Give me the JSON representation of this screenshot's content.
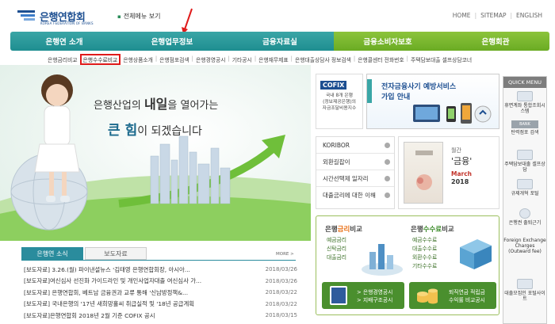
{
  "header": {
    "logo_name": "은행연합회",
    "logo_sub": "KOREA FEDERATION OF BANKS",
    "all_menu": "전체메뉴 보기",
    "util": [
      "HOME",
      "SITEMAP",
      "ENGLISH"
    ]
  },
  "nav": {
    "items": [
      "은행연 소개",
      "은행업무정보",
      "금융자료실",
      "금융소비자보호",
      "은행회관"
    ]
  },
  "subnav": {
    "items": [
      "은행금리비교",
      "은행수수료비교",
      "은행상품소개",
      "은행점포검색",
      "은행경영공시",
      "기타공시",
      "은행재무제표",
      "은행대출상담사 정보검색",
      "은행콜센터 전화번호",
      "주택담보대출 셀프상담코너"
    ]
  },
  "hero": {
    "line1_a": "은행산업의",
    "line1_b": "내일",
    "line1_c": "을 열어가는",
    "line2_a": "큰",
    "line2_b": "힘",
    "line2_c": "이 되겠습니다"
  },
  "news": {
    "tabs": [
      "은행연 소식",
      "보도자료"
    ],
    "more": "MORE >",
    "rows": [
      {
        "title": "[보도자료] 3.26.(월) 파이낸셜뉴스 '김태영 은행연합회장, 아시아...",
        "date": "2018/03/26"
      },
      {
        "title": "[보도자료]여신심사 선진화 가이드라인 및 개인사업자대출 여신심사 가...",
        "date": "2018/03/26"
      },
      {
        "title": "[보도자료] 은행연합회, 베트남 금융권과 교류 통해 '신남방정책&...",
        "date": "2018/03/22"
      },
      {
        "title": "[보도자료] 국내은행의 '17년 새희망홀씨 취급실적 및 '18년 공급계획",
        "date": "2018/03/22"
      },
      {
        "title": "[보도자료]은행연합회 2018년 2월 기준 COFIX 공시",
        "date": "2018/03/15"
      }
    ]
  },
  "cofix": {
    "logo": "COFIX",
    "text": [
      "국내 8개 은행",
      "(정보제공은행)의",
      "자금조달비용지수"
    ]
  },
  "efin": {
    "line1": "전자금융사기 예방서비스",
    "line2": "가입 안내"
  },
  "quick": {
    "title": "QUICK MENU",
    "items": [
      "휴면계좌 통합조회시스템",
      "탄력점포 검색",
      "주택담보대출 셀프상담",
      "규제개혁 포털",
      "은행권 출퇴근기",
      "Foreign Exchange Charges (Outward fee)",
      "대출모집인 포털사이트"
    ],
    "bank_label": "BANK"
  },
  "korlist": {
    "items": [
      "KORIBOR",
      "외환길잡이",
      "시간선택제 일자리",
      "대출금리에 대한 이해"
    ]
  },
  "magazine": {
    "label": "월간",
    "name": "'금융'",
    "month": "March",
    "year": "2018"
  },
  "compare": {
    "rate_title_a": "은행",
    "rate_title_b": "금리",
    "rate_title_c": "비교",
    "rate_items": [
      "예금금리",
      "신탁금리",
      "대출금리"
    ],
    "fee_title_a": "은행",
    "fee_title_b": "수수료",
    "fee_title_c": "비교",
    "fee_items": [
      "예금수수료",
      "대출수수료",
      "외환수수료",
      "기타수수료"
    ],
    "btn_left": [
      "> 은행경영공시",
      "> 지배구조공시"
    ],
    "btn_right": [
      "퇴직연금 적립금",
      "수익률 비교공시"
    ]
  },
  "colors": {
    "nav_teal": "#1e8e90",
    "nav_green": "#6aab23",
    "brand_blue": "#1d4f91",
    "highlight_red": "#e01a1a"
  }
}
